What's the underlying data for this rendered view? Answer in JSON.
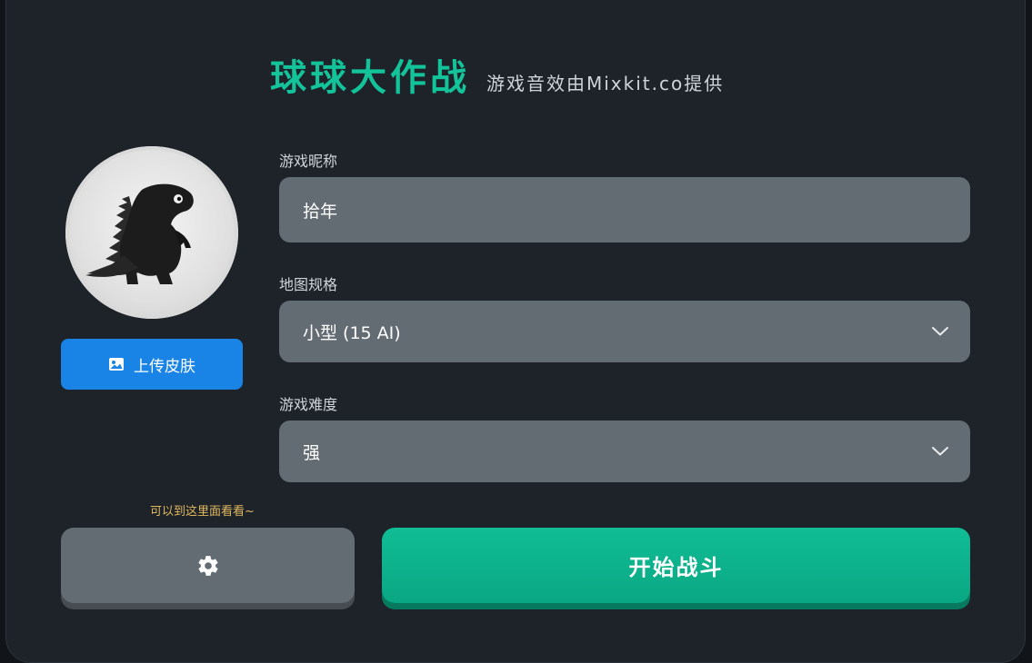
{
  "header": {
    "title": "球球大作战",
    "subtitle": "游戏音效由Mixkit.co提供"
  },
  "skin": {
    "upload_label": "上传皮肤",
    "upload_icon": "image-icon",
    "avatar": "dinosaur-avatar"
  },
  "form": {
    "nickname_label": "游戏昵称",
    "nickname_value": "拾年",
    "map_label": "地图规格",
    "map_value": "小型 (15 AI)",
    "difficulty_label": "游戏难度",
    "difficulty_value": "强"
  },
  "footer": {
    "hint": "可以到这里面看看~",
    "settings_icon": "gear-icon",
    "start_label": "开始战斗"
  },
  "colors": {
    "accent": "#13c49b",
    "panel": "#1e232a",
    "field": "#646c73",
    "upload": "#1a84e6",
    "hint": "#e0b85e"
  }
}
